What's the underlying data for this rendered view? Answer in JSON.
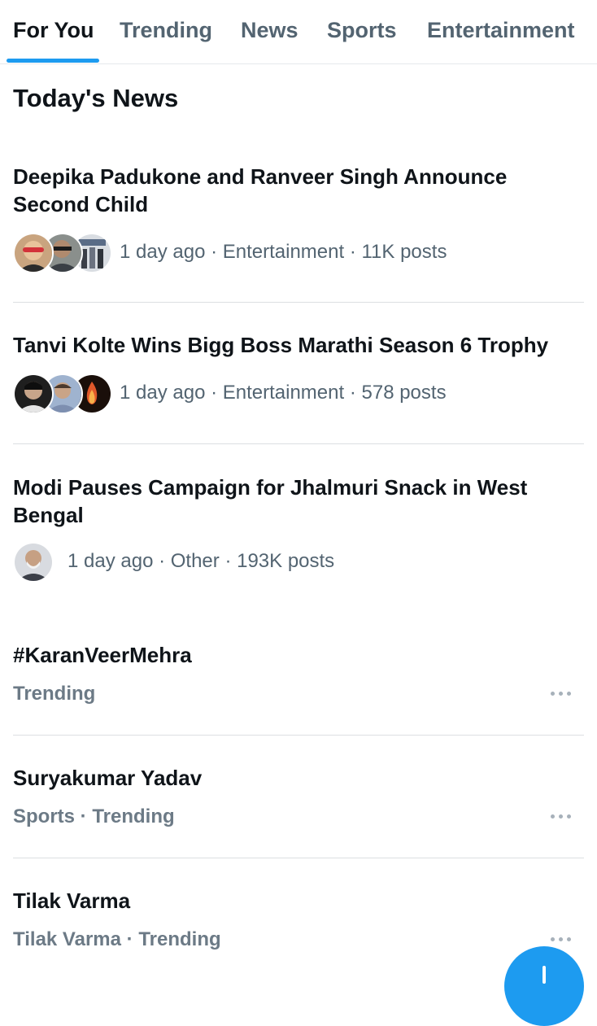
{
  "tabs": [
    {
      "label": "For You",
      "active": true
    },
    {
      "label": "Trending",
      "active": false
    },
    {
      "label": "News",
      "active": false
    },
    {
      "label": "Sports",
      "active": false
    },
    {
      "label": "Entertainment",
      "active": false
    }
  ],
  "section": {
    "title": "Today's News"
  },
  "news": [
    {
      "headline": "Deepika Padukone and Ranveer Singh Announce Second Child",
      "meta": "1 day ago · Entertainment · 11K posts",
      "avatar_count": 3
    },
    {
      "headline": "Tanvi Kolte Wins Bigg Boss Marathi Season 6 Trophy",
      "meta": "1 day ago · Entertainment · 578 posts",
      "avatar_count": 3
    },
    {
      "headline": "Modi Pauses Campaign for Jhalmuri Snack in West Bengal",
      "meta": "1 day ago · Other · 193K posts",
      "avatar_count": 1
    }
  ],
  "trends": [
    {
      "name": "#KaranVeerMehra",
      "context": "Trending"
    },
    {
      "name": "Suryakumar Yadav",
      "context": "Sports · Trending"
    },
    {
      "name": "Tilak Varma",
      "context": "Tilak Varma · Trending"
    }
  ],
  "colors": {
    "accent": "#1d9bf0",
    "text_primary": "#0f1419",
    "text_secondary": "#536471",
    "divider": "#dcdfe2"
  },
  "icons": {
    "more": "more-horizontal-icon",
    "compose": "compose-plus-icon"
  }
}
